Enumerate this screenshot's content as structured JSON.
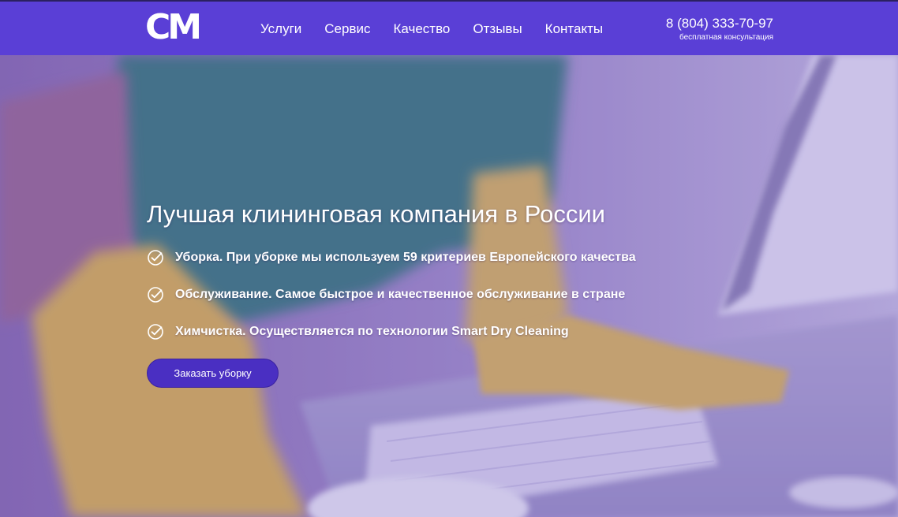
{
  "header": {
    "logo_text": "CM",
    "nav": [
      {
        "label": "Услуги"
      },
      {
        "label": "Сервис"
      },
      {
        "label": "Качество"
      },
      {
        "label": "Отзывы"
      },
      {
        "label": "Контакты"
      }
    ],
    "phone": "8 (804) 333-70-97",
    "phone_caption": "бесплатная консультация"
  },
  "hero": {
    "title": "Лучшая клининговая компания в России",
    "features": [
      {
        "text": "Уборка. При уборке мы используем 59 критериев Европейского качества",
        "icon": "check-circle-icon"
      },
      {
        "text": "Обслуживание. Самое быстрое и качественное обслуживание в стране",
        "icon": "check-circle-icon"
      },
      {
        "text": "Химчистка. Осуществляется по технологии Smart Dry Cleaning",
        "icon": "check-circle-icon"
      }
    ],
    "cta_label": "Заказать уборку"
  },
  "colors": {
    "header_bg": "#5a3fd6",
    "cta_bg": "#4a2fc2",
    "text": "#ffffff"
  }
}
